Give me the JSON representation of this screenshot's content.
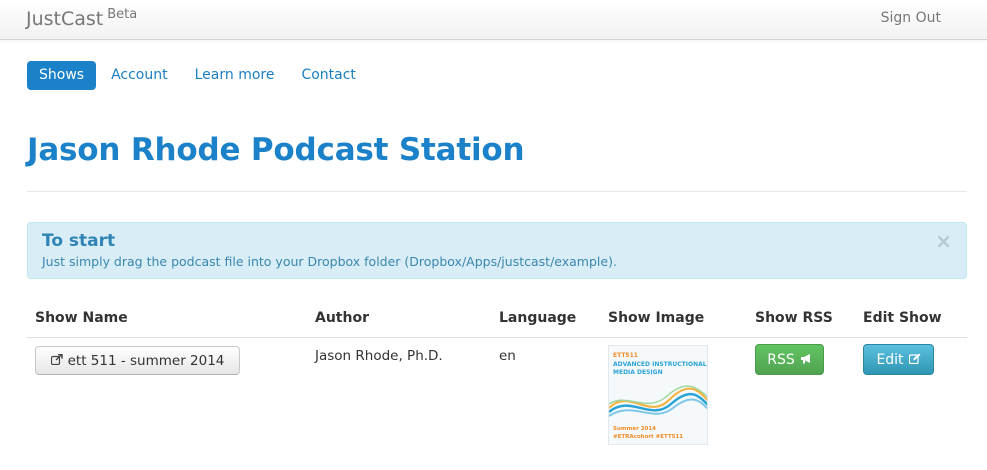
{
  "navbar": {
    "brand": "JustCast",
    "badge": "Beta",
    "signout": "Sign Out"
  },
  "nav": [
    {
      "label": "Shows",
      "active": true
    },
    {
      "label": "Account",
      "active": false
    },
    {
      "label": "Learn more",
      "active": false
    },
    {
      "label": "Contact",
      "active": false
    }
  ],
  "page": {
    "title": "Jason Rhode Podcast Station"
  },
  "alert": {
    "title": "To start",
    "body": "Just simply drag the podcast file into your Dropbox folder (Dropbox/Apps/justcast/example).",
    "close": "×"
  },
  "table": {
    "headers": [
      "Show Name",
      "Author",
      "Language",
      "Show Image",
      "Show RSS",
      "Edit Show"
    ],
    "rows": [
      {
        "show_name": "ett 511 - summer 2014",
        "author": "Jason Rhode, Ph.D.",
        "language": "en",
        "image": {
          "line1": "ETT511",
          "line2": "ADVANCED INSTRUCTIONAL MEDIA DESIGN",
          "line3": "Summer 2014",
          "line4": "#ETRAcohort #ETT511"
        },
        "rss_label": "RSS",
        "edit_label": "Edit"
      }
    ]
  },
  "icons": {
    "share": "share-icon",
    "bullhorn": "bullhorn-icon",
    "edit": "edit-icon",
    "close": "close-icon"
  },
  "colors": {
    "primary": "#1b82c9",
    "success": "#5bb75b",
    "info": "#49afcd",
    "alert_bg": "#d9edf7"
  }
}
